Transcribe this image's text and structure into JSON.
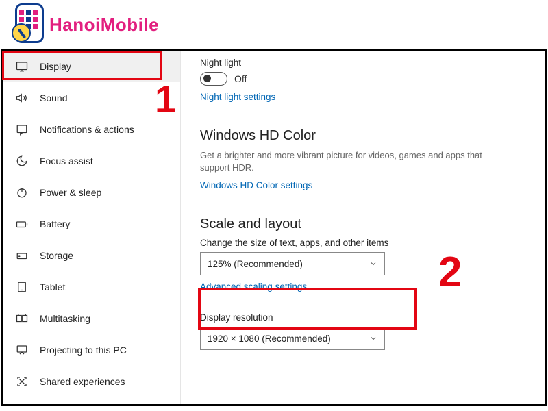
{
  "logo": {
    "text": "HanoiMobile"
  },
  "sidebar": {
    "items": [
      {
        "label": "Display"
      },
      {
        "label": "Sound"
      },
      {
        "label": "Notifications & actions"
      },
      {
        "label": "Focus assist"
      },
      {
        "label": "Power & sleep"
      },
      {
        "label": "Battery"
      },
      {
        "label": "Storage"
      },
      {
        "label": "Tablet"
      },
      {
        "label": "Multitasking"
      },
      {
        "label": "Projecting to this PC"
      },
      {
        "label": "Shared experiences"
      }
    ]
  },
  "content": {
    "night_light": {
      "label": "Night light",
      "state": "Off",
      "link": "Night light settings"
    },
    "hd_color": {
      "title": "Windows HD Color",
      "desc": "Get a brighter and more vibrant picture for videos, games and apps that support HDR.",
      "link": "Windows HD Color settings"
    },
    "scale": {
      "title": "Scale and layout",
      "change_label": "Change the size of text, apps, and other items",
      "scale_value": "125% (Recommended)",
      "advanced_link": "Advanced scaling settings",
      "resolution_label": "Display resolution",
      "resolution_value": "1920 × 1080 (Recommended)"
    }
  },
  "annotations": {
    "one": "1",
    "two": "2"
  }
}
